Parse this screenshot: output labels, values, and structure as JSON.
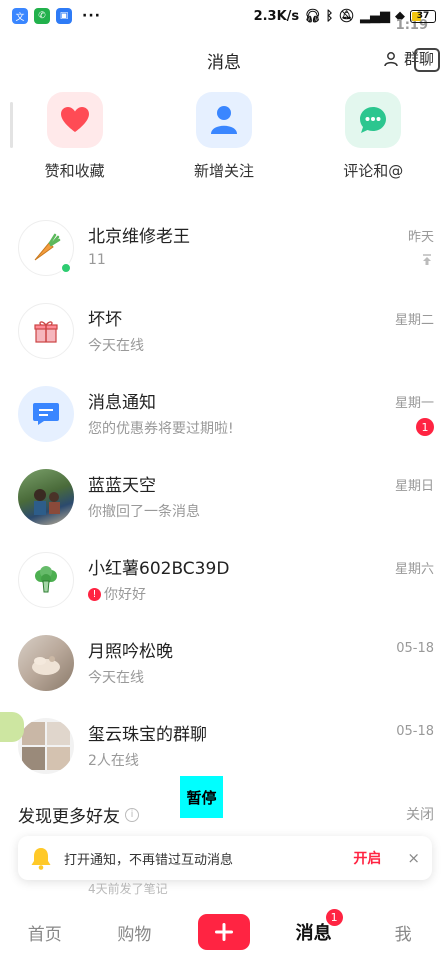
{
  "status_bar": {
    "time": "1:19",
    "network_speed": "2.3K/s",
    "battery": "37",
    "more": "···"
  },
  "header": {
    "title": "消息",
    "group_label": "群聊"
  },
  "categories": [
    {
      "label": "赞和收藏",
      "icon": "heart-icon"
    },
    {
      "label": "新增关注",
      "icon": "person-icon"
    },
    {
      "label": "评论和@",
      "icon": "chat-bubble-icon"
    }
  ],
  "conversations": [
    {
      "name": "北京维修老王",
      "sub": "11",
      "time": "昨天",
      "avatar": "carrot-avatar",
      "online": true,
      "pinned": true
    },
    {
      "name": "坏坏",
      "sub": "今天在线",
      "time": "星期二",
      "avatar": "gift-avatar"
    },
    {
      "name": "消息通知",
      "sub": "您的优惠券将要过期啦!",
      "time": "星期一",
      "avatar": "notification-avatar",
      "badge": "1"
    },
    {
      "name": "蓝蓝天空",
      "sub": "你撤回了一条消息",
      "time": "星期日",
      "avatar": "photo-avatar-outdoor"
    },
    {
      "name": "小红薯602BC39D",
      "sub": "你好好",
      "time": "星期六",
      "avatar": "broccoli-avatar",
      "error_mark": "!"
    },
    {
      "name": "月照吟松晚",
      "sub": "今天在线",
      "time": "05-18",
      "avatar": "photo-avatar-hands"
    },
    {
      "name": "玺云珠宝的群聊",
      "sub": "2人在线",
      "time": "05-18",
      "avatar": "group-avatar"
    }
  ],
  "discover": {
    "title": "发现更多好友",
    "close": "关闭"
  },
  "pause_label": "暂停",
  "toast": {
    "text": "打开通知，不再错过互动消息",
    "open": "开启",
    "close": "×"
  },
  "peek_text": "4天前发了笔记",
  "tabbar": {
    "home": "首页",
    "shop": "购物",
    "messages": "消息",
    "messages_badge": "1",
    "me": "我"
  },
  "colors": {
    "brand_red": "#ff2442",
    "online_green": "#2ecc71",
    "note_blue": "#3a86ff"
  }
}
